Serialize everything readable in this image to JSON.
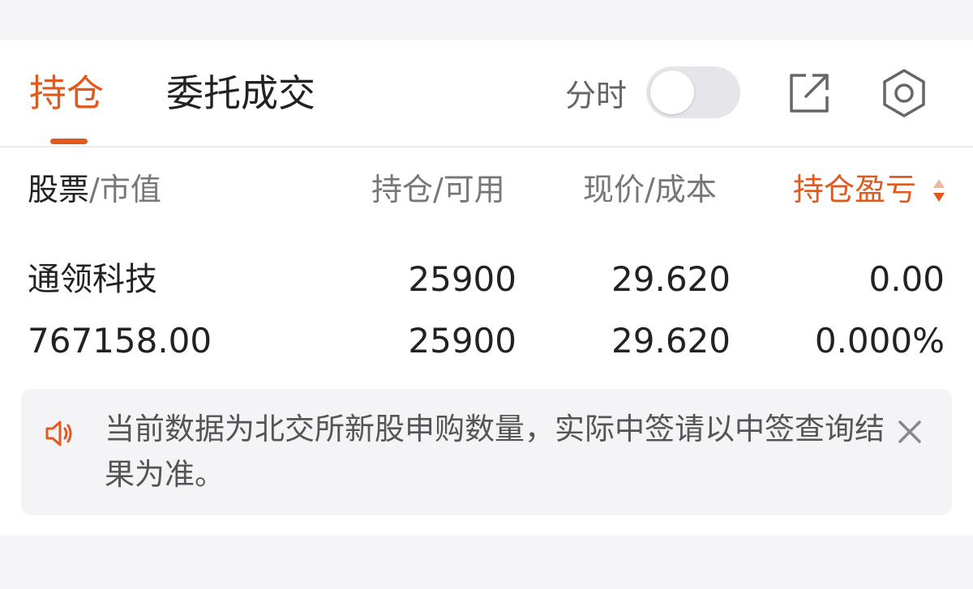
{
  "tabs": [
    {
      "label": "持仓",
      "active": true
    },
    {
      "label": "委托成交",
      "active": false
    }
  ],
  "fenshi": {
    "label": "分时",
    "enabled": false
  },
  "icons": {
    "share": "external-link-icon",
    "settings": "gear-icon",
    "notice": "speaker-icon",
    "close": "close-icon",
    "sort": "sort-arrows-icon"
  },
  "columns": {
    "stock_primary": "股票",
    "stock_secondary": "/市值",
    "position": "持仓/可用",
    "price": "现价/成本",
    "pnl": "持仓盈亏"
  },
  "holdings": [
    {
      "name": "通领科技",
      "market_value": "767158.00",
      "position": "25900",
      "available": "25900",
      "price": "29.620",
      "cost": "29.620",
      "pnl": "0.00",
      "pnl_pct": "0.000%"
    }
  ],
  "notice": {
    "text": "当前数据为北交所新股申购数量，实际中签请以中签查询结果为准。"
  },
  "colors": {
    "accent": "#e05a1f",
    "text": "#222222",
    "muted": "#777777",
    "notice_bg": "#f4f4f6"
  }
}
